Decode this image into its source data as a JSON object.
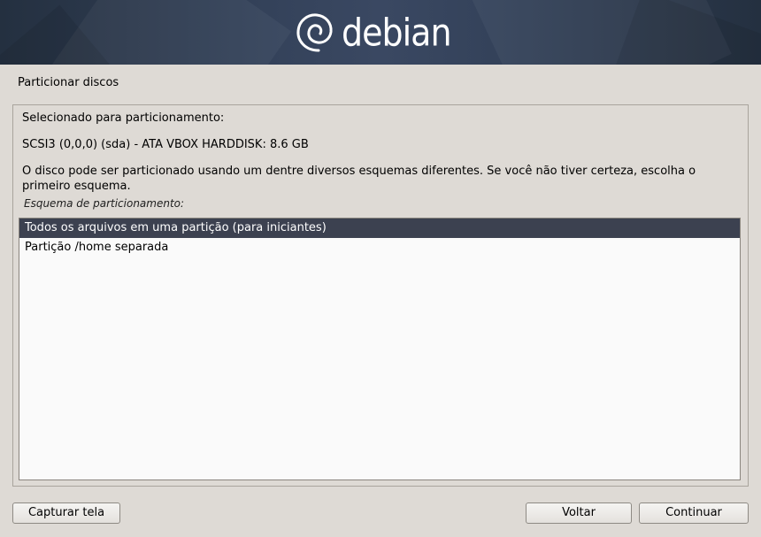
{
  "banner": {
    "logo_text": "debian",
    "logo_icon": "debian-swirl-icon"
  },
  "page": {
    "title": "Particionar discos"
  },
  "content": {
    "selected_label": "Selecionado para particionamento:",
    "disk": "SCSI3 (0,0,0) (sda) - ATA VBOX HARDDISK: 8.6 GB",
    "description": "O disco pode ser particionado usando um dentre diversos esquemas diferentes. Se você não tiver certeza, escolha o primeiro esquema.",
    "list_label": "Esquema de particionamento:",
    "options": [
      {
        "label": "Todos os arquivos em uma partição (para iniciantes)",
        "selected": true
      },
      {
        "label": "Partição /home separada",
        "selected": false
      }
    ]
  },
  "buttons": {
    "capture": "Capturar tela",
    "back": "Voltar",
    "continue": "Continuar"
  },
  "colors": {
    "banner": "#34425a",
    "selection": "#3c4150",
    "background": "#dedad5"
  }
}
